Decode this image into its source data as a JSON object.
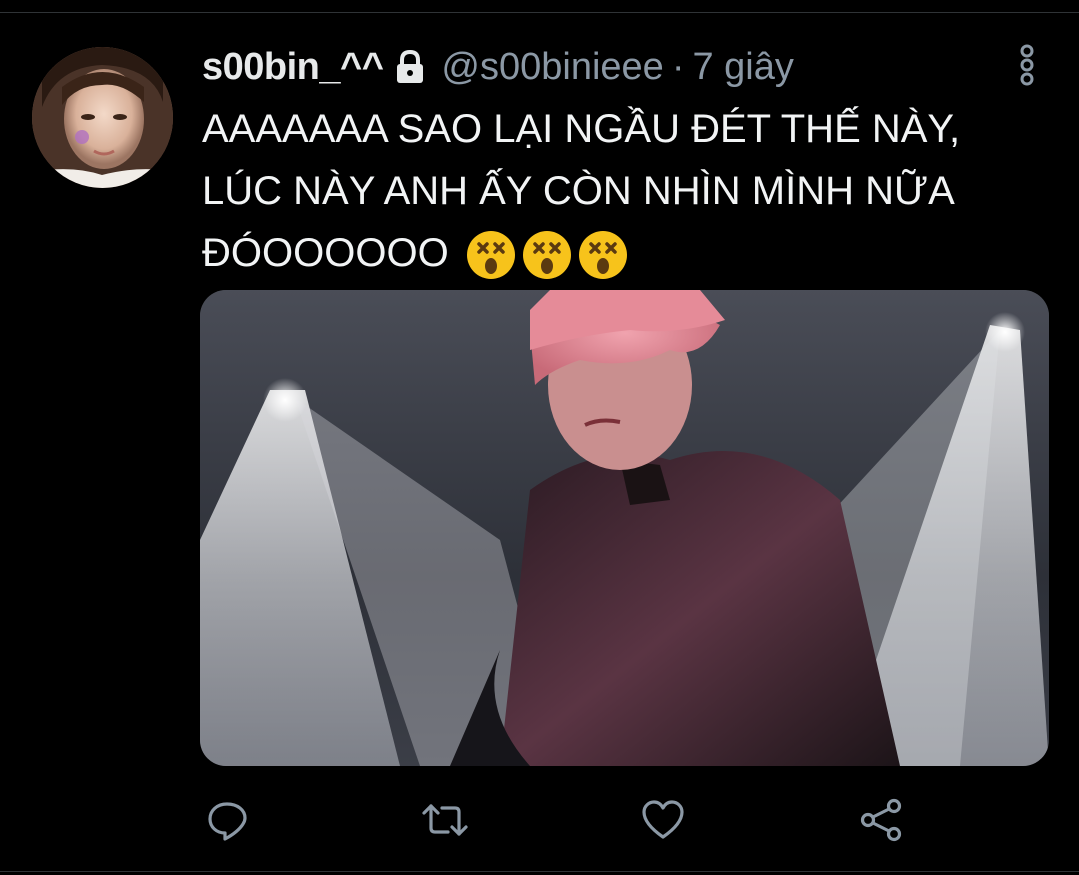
{
  "tweet": {
    "display_name": "s00bin_^^",
    "handle": "@s00binieee",
    "separator": "·",
    "time": "7 giây",
    "text_lines": [
      "AAAAAAA SAO LẠI NGẦU ĐÉT THẾ NÀY,",
      "LÚC NÀY ANH ẤY CÒN NHÌN MÌNH NỮA",
      "ĐÓOOOOOO"
    ],
    "emojis": [
      "dizzy-face",
      "dizzy-face",
      "dizzy-face"
    ],
    "protected": true
  },
  "actions": {
    "icons": [
      "reply-icon",
      "retweet-icon",
      "like-icon",
      "share-icon"
    ]
  },
  "colors": {
    "background": "#000000",
    "text_primary": "#e7e9ea",
    "text_secondary": "#8b98a5",
    "icon": "#8b98a5",
    "divider": "#2f3336"
  }
}
